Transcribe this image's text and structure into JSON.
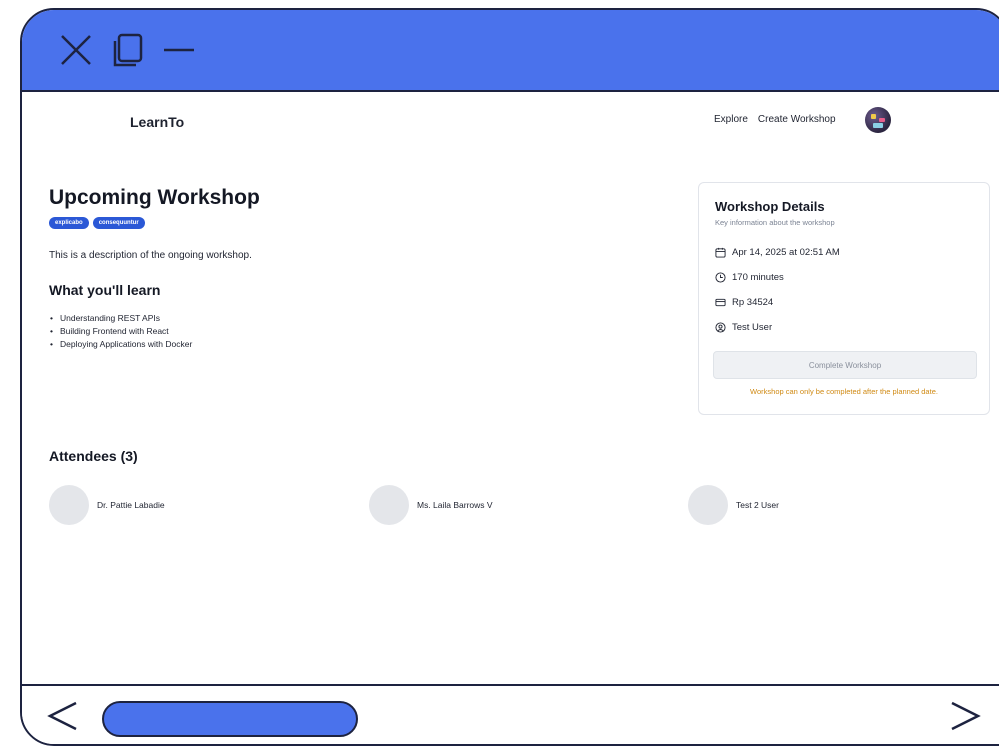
{
  "window": {
    "controls": [
      "close-icon",
      "maximize-icon",
      "minimize-icon"
    ],
    "accent_color": "#4a72ec"
  },
  "header": {
    "brand": "LearnTo",
    "nav": {
      "explore": "Explore",
      "create": "Create Workshop"
    }
  },
  "workshop": {
    "title": "Upcoming Workshop",
    "tags": [
      "explicabo",
      "consequuntur"
    ],
    "description": "This is a description of the ongoing workshop.",
    "learn_heading": "What you'll learn",
    "learn_items": [
      "Understanding REST APIs",
      "Building Frontend with React",
      "Deploying Applications with Docker"
    ]
  },
  "details": {
    "title": "Workshop Details",
    "subtitle": "Key information about the workshop",
    "date": "Apr 14, 2025 at 02:51 AM",
    "duration": "170 minutes",
    "price": "Rp 34524",
    "host": "Test User",
    "button": "Complete Workshop",
    "warning": "Workshop can only be completed after the planned date.",
    "warning_color": "#d08a14"
  },
  "attendees": {
    "heading": "Attendees (3)",
    "list": [
      "Dr. Pattie Labadie",
      "Ms. Laila Barrows V",
      "Test 2 User"
    ]
  }
}
